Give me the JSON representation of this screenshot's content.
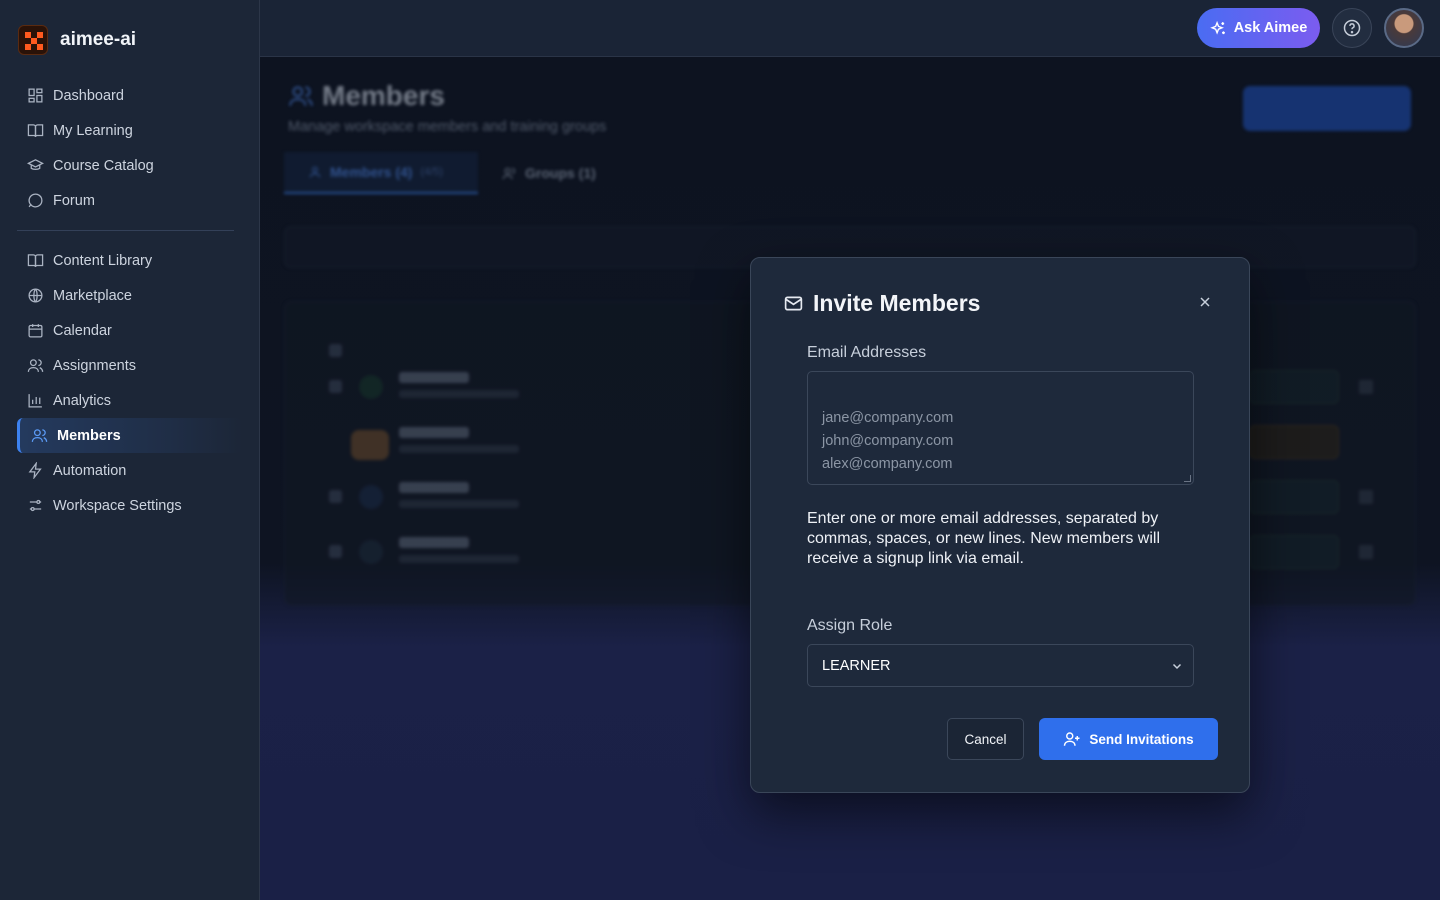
{
  "brand": {
    "name": "aimee-ai"
  },
  "sidebar": {
    "primary": [
      {
        "label": "Dashboard",
        "icon": "dashboard-icon"
      },
      {
        "label": "My Learning",
        "icon": "book-open-icon"
      },
      {
        "label": "Course Catalog",
        "icon": "graduation-cap-icon"
      },
      {
        "label": "Forum",
        "icon": "chat-bubble-icon"
      }
    ],
    "secondary": [
      {
        "label": "Content Library",
        "icon": "book-open-icon"
      },
      {
        "label": "Marketplace",
        "icon": "globe-icon"
      },
      {
        "label": "Calendar",
        "icon": "calendar-icon"
      },
      {
        "label": "Assignments",
        "icon": "users-icon"
      },
      {
        "label": "Analytics",
        "icon": "bar-chart-icon"
      },
      {
        "label": "Members",
        "icon": "users-icon",
        "active": true
      },
      {
        "label": "Automation",
        "icon": "lightning-icon"
      },
      {
        "label": "Workspace Settings",
        "icon": "sliders-icon"
      }
    ]
  },
  "topbar": {
    "ask_label": "Ask Aimee"
  },
  "page": {
    "title": "Members",
    "subtitle": "Manage workspace members and training groups",
    "tabs": [
      {
        "label": "Members (4)",
        "count": "(4/5)"
      },
      {
        "label": "Groups (1)"
      }
    ]
  },
  "modal": {
    "title": "Invite Members",
    "email_label": "Email Addresses",
    "email_placeholder": "jane@company.com\njohn@company.com\nalex@company.com",
    "helper_text": "Enter one or more email addresses, separated by commas, spaces, or new lines. New members will receive a signup link via email.",
    "role_label": "Assign Role",
    "role_value": "LEARNER",
    "cancel_label": "Cancel",
    "send_label": "Send Invitations"
  },
  "colors": {
    "accent": "#2f6fec",
    "brand": "#ff5a1f",
    "ask_gradient_start": "#4a6cf2",
    "ask_gradient_end": "#7b5cf0"
  }
}
